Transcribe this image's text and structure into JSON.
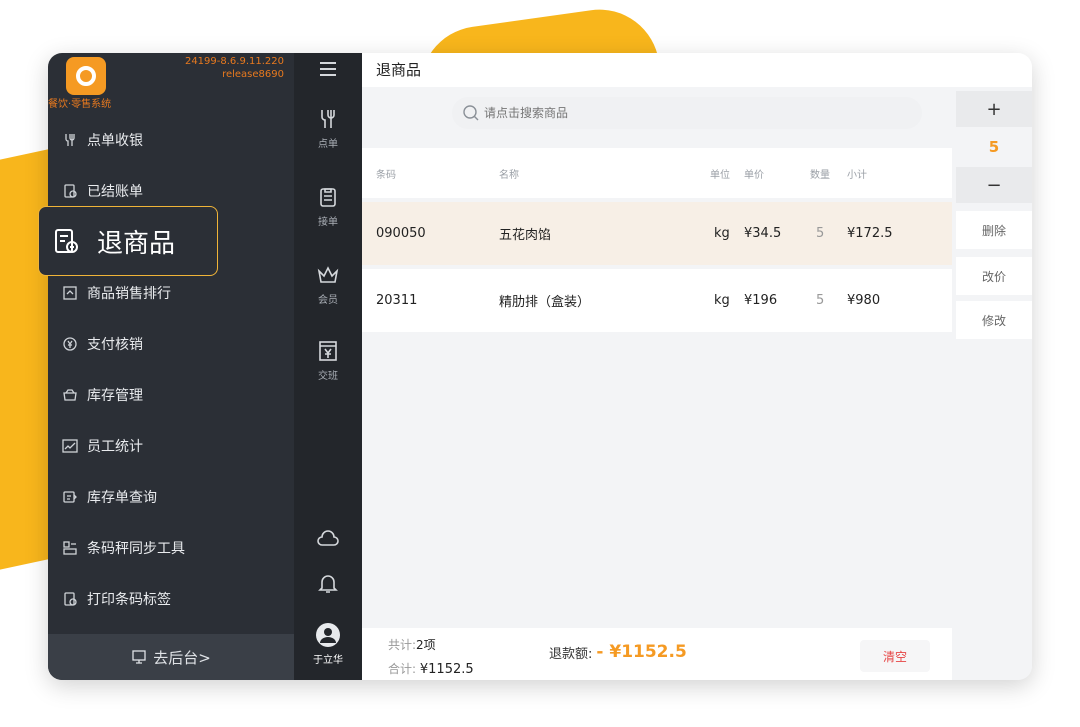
{
  "app": {
    "version_line1": "24199-8.6.9.11.220",
    "version_line2": "release8690",
    "subtitle": "餐饮·零售系统"
  },
  "sidebar": {
    "items": [
      {
        "label": "点单收银",
        "icon": "cutlery-icon"
      },
      {
        "label": "已结账单",
        "icon": "receipt-icon"
      },
      {
        "label": "退商品",
        "icon": "return-receipt-icon"
      },
      {
        "label": "商品销售排行",
        "icon": "ranking-icon"
      },
      {
        "label": "支付核销",
        "icon": "yen-circle-icon"
      },
      {
        "label": "库存管理",
        "icon": "box-icon"
      },
      {
        "label": "员工统计",
        "icon": "chart-icon"
      },
      {
        "label": "库存单查询",
        "icon": "stock-query-icon"
      },
      {
        "label": "条码秤同步工具",
        "icon": "scale-icon"
      },
      {
        "label": "打印条码标签",
        "icon": "print-label-icon"
      }
    ],
    "back_office": "去后台>"
  },
  "highlight": {
    "label": "退商品"
  },
  "iconbar": {
    "items": [
      {
        "label": "点单",
        "icon": "cutlery-icon"
      },
      {
        "label": "接单",
        "icon": "clipboard-icon"
      },
      {
        "label": "会员",
        "icon": "crown-icon"
      },
      {
        "label": "交班",
        "icon": "cash-register-icon"
      }
    ],
    "user": "于立华"
  },
  "main": {
    "title": "退商品",
    "search_placeholder": "请点击搜索商品",
    "columns": [
      "条码",
      "名称",
      "单位",
      "单价",
      "数量",
      "小计"
    ],
    "rows": [
      {
        "code": "090050",
        "name": "五花肉馅",
        "unit": "kg",
        "price": "¥34.5",
        "qty": "5",
        "subtotal": "¥172.5",
        "selected": true
      },
      {
        "code": "20311",
        "name": "精肋排（盒装）",
        "unit": "kg",
        "price": "¥196",
        "qty": "5",
        "subtotal": "¥980",
        "selected": false
      }
    ],
    "footer": {
      "count_label": "共计:",
      "count_value": "2项",
      "total_label": "合计:",
      "total_value": "¥1152.5",
      "refund_label": "退款额:",
      "refund_value": "- ¥1152.5",
      "clear": "清空"
    }
  },
  "right_panel": {
    "plus": "+",
    "quantity": "5",
    "minus": "−",
    "delete": "删除",
    "change_price": "改价",
    "modify": "修改"
  },
  "colors": {
    "accent": "#f59a23",
    "selected_row": "#f7efe6",
    "sidebar_bg": "#2b2f36",
    "iconbar_bg": "#23262b",
    "highlight_border": "#f0b438",
    "clear_red": "#e64545"
  }
}
